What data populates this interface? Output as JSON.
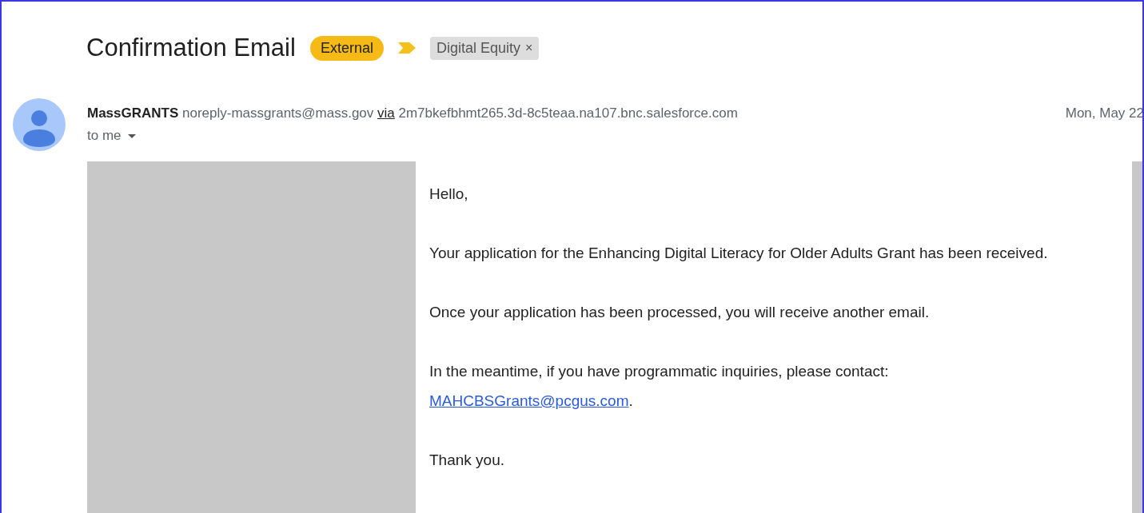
{
  "subject": "Confirmation Email",
  "labels": [
    {
      "text": "External",
      "kind": "badge"
    },
    {
      "text": "Digital Equity",
      "kind": "removable",
      "remove": "×"
    }
  ],
  "sender": {
    "name": "MassGRANTS",
    "email": "noreply-massgrants@mass.gov",
    "via": "via",
    "domain": "2m7bkefbhmt265.3d-8c5teaa.na107.bnc.salesforce.com",
    "date": "Mon, May 22",
    "recipient": "to me"
  },
  "body": [
    {
      "text": "Hello,"
    },
    {
      "text": "Your application for the Enhancing Digital Literacy for Older Adults Grant has been received."
    },
    {
      "text": "Once your application has been processed, you will receive another email."
    },
    {
      "text": "In the meantime, if you have programmatic inquiries, please contact: ",
      "link": "MAHCBSGrants@pcgus.com",
      "after": "."
    },
    {
      "text": "Thank you."
    }
  ]
}
